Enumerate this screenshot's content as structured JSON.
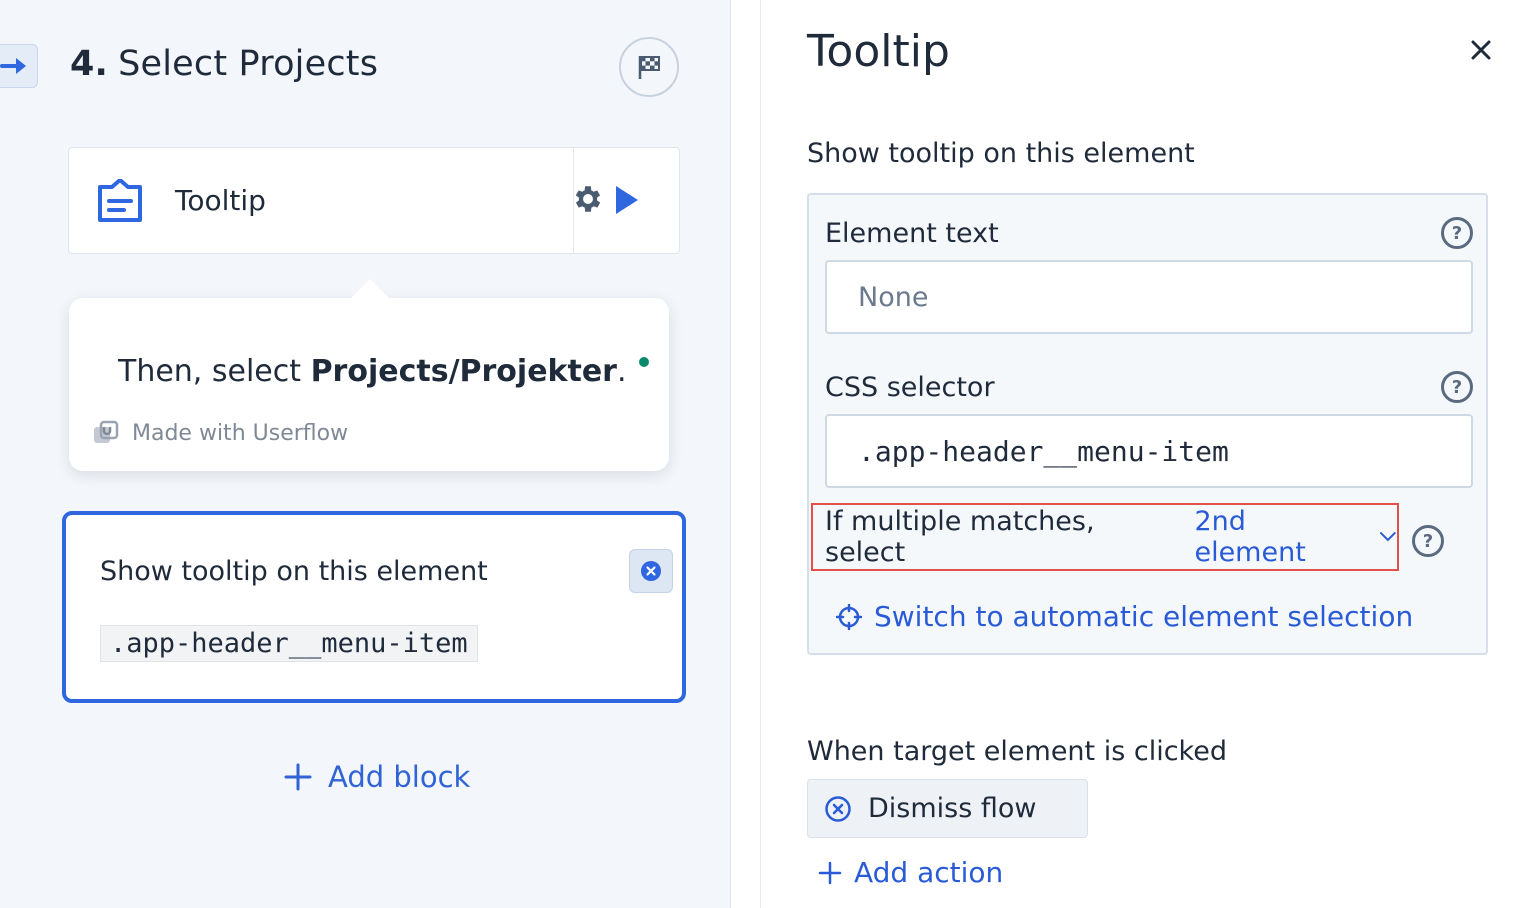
{
  "colors": {
    "accent": "#2f67e0",
    "highlight_border": "#e2504a",
    "status_dot": "#0b8a6b"
  },
  "step": {
    "number": "4.",
    "title": "Select Projects"
  },
  "block": {
    "label": "Tooltip",
    "icons": [
      "tooltip-icon",
      "gear-icon",
      "play-icon"
    ]
  },
  "preview": {
    "text_before": "Then, select ",
    "text_bold": "Projects/Projekter",
    "text_after": ".",
    "made_with": "Made with Userflow"
  },
  "target": {
    "title": "Show tooltip on this element",
    "selector": ".app-header__menu-item"
  },
  "add_block_label": "Add block",
  "panel": {
    "title": "Tooltip",
    "subtitle": "Show tooltip on this element",
    "element_text_label": "Element text",
    "element_text_value": "None",
    "css_selector_label": "CSS selector",
    "css_selector_value": ".app-header__menu-item",
    "multiple_label": "If multiple matches, select",
    "multiple_value": "2nd element",
    "switch_label": "Switch to automatic element selection",
    "clicked_label": "When target element is clicked",
    "dismiss_label": "Dismiss flow",
    "add_action_label": "Add action",
    "help_symbol": "?"
  }
}
